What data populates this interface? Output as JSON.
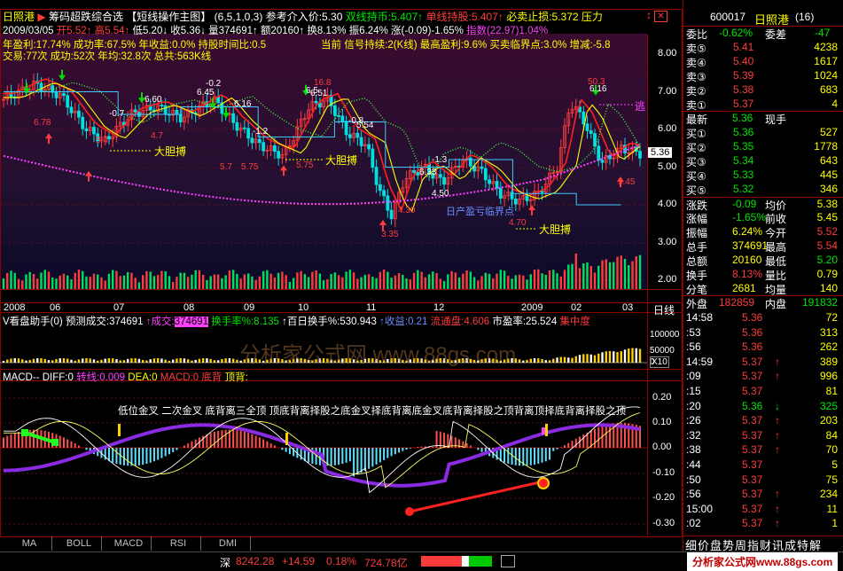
{
  "header": {
    "stock_name": "日照港",
    "indicator_name": "筹码超跌综合选",
    "template_name": "【短线操作主图】",
    "params": "(6,5,1,0,3)",
    "ref_price_label": "参考介入价:",
    "ref_price": "5.30",
    "hold_label": "双线持币:",
    "hold_value": "5.407",
    "single_label": "单线持股:",
    "single_value": "5.407",
    "stop_label": "必卖止损:",
    "stop_value": "5.372",
    "pressure_label": "压力",
    "up_arrow": "↑",
    "down_arrow": "↓"
  },
  "ohlc_bar": {
    "date": "2009/03/05",
    "open": "开5.52",
    "high": "高5.54",
    "low": "低5.20",
    "close": "收5.36",
    "vol": "量374691",
    "amount": "额20160",
    "turnover": "换8.13%",
    "amplitude": "振6.24%",
    "change": "涨(-0.09)-1.65%",
    "index": "指数(22.97)1.04%"
  },
  "stats_line1": {
    "left": "年盈利:17.74% 成功率:67.5% 年收益:0.0% 持股时间比:0.5",
    "right": "当前 信号持续:2(K线) 最高盈利:9.6% 买卖临界点:3.0% 增减:-5.8"
  },
  "stats_line2": "交易:77次 成功:52次 年均:32.8次 总共:563K线",
  "chart_annotations": {
    "big_buy": "大胆搏",
    "escape": "逃",
    "mid_point": "日产盈亏临界点",
    "labels": [
      "6.78",
      "6.60",
      "6.45",
      "-0.2",
      "6.16",
      "-0.7",
      "4.7",
      "6.5",
      "-1.2",
      "5.7",
      "6.51",
      "16.8",
      "-0.8",
      "5.75",
      "5.54",
      "5.4",
      "6.33",
      "-1.3",
      "4.30",
      "4.50",
      "3.35",
      "50.3",
      "6.16",
      "5.45",
      "5.75",
      "4.70"
    ]
  },
  "price_axis": [
    "8.00",
    "7.00",
    "6.00",
    "5.00",
    "4.00",
    "3.00",
    "2.00"
  ],
  "current_price_tag": "5.36",
  "date_axis": [
    "2008",
    "06",
    "07",
    "08",
    "09",
    "10",
    "11",
    "12",
    "2009",
    "02",
    "03"
  ],
  "date_axis_right": "日线",
  "vol_panel": {
    "title": "V看盘助手(0)",
    "predict": "预测成交:374691",
    "traded_label": "↑成交:",
    "traded_value": "374691",
    "turnover_label": "换手率%:",
    "turnover_value": "8.135",
    "hundred_label": "↑百日换手%:",
    "hundred_value": "530.943",
    "gain_label": "↑收益:",
    "gain_value": "0.21",
    "float_label": "流通盘:",
    "float_value": "4.606",
    "pe_label": "市盈率:",
    "pe_value": "25.524",
    "conc_label": "集中度",
    "axis": [
      "100000",
      "50000",
      "0"
    ],
    "axis_mult": "X10",
    "watermark": "分析家公式网 www.88gs.com"
  },
  "macd_panel": {
    "title": "MACD--",
    "diff": "DIFF:0",
    "turn_label": "转线:",
    "turn_value": "0.009",
    "dea": "DEA:0",
    "macd": "MACD:0",
    "bottom_label": "底背",
    "top_label": "顶背:",
    "signals": "低位金叉 二次金叉 底背离三全顶 顶底背离择股之底金叉择底背离底金叉底背离择股之顶背离顶择底背离择股之顶",
    "axis": [
      "0.20",
      "0.10",
      "0.00",
      "-0.10",
      "-0.20",
      "-0.30"
    ]
  },
  "tabs": [
    "MA",
    "BOLL",
    "MACD",
    "RSI",
    "DMI"
  ],
  "right": {
    "code": "600017",
    "name": "日照港",
    "page": "(16)",
    "webi_label": "委比",
    "webi_value": "-0.62%",
    "weicha_label": "委差",
    "weicha_value": "-47",
    "asks": [
      {
        "label": "卖⑤",
        "price": "5.41",
        "vol": "4238"
      },
      {
        "label": "卖④",
        "price": "5.40",
        "vol": "1617"
      },
      {
        "label": "卖③",
        "price": "5.39",
        "vol": "1024"
      },
      {
        "label": "卖②",
        "price": "5.38",
        "vol": "683"
      },
      {
        "label": "卖①",
        "price": "5.37",
        "vol": "4"
      }
    ],
    "last_label": "最新",
    "last_value": "5.36",
    "last_type": "现手",
    "bids": [
      {
        "label": "买①",
        "price": "5.36",
        "vol": "527"
      },
      {
        "label": "买②",
        "price": "5.35",
        "vol": "1778"
      },
      {
        "label": "买③",
        "price": "5.34",
        "vol": "643"
      },
      {
        "label": "买④",
        "price": "5.33",
        "vol": "445"
      },
      {
        "label": "买⑤",
        "price": "5.32",
        "vol": "346"
      }
    ],
    "stats": [
      {
        "l1": "涨跌",
        "v1": "-0.09",
        "l2": "均价",
        "v2": "5.38"
      },
      {
        "l1": "涨幅",
        "v1": "-1.65%",
        "l2": "前收",
        "v2": "5.45"
      },
      {
        "l1": "振幅",
        "v1": "6.24%",
        "l2": "今开",
        "v2": "5.52"
      },
      {
        "l1": "总手",
        "v1": "374691",
        "l2": "最高",
        "v2": "5.54"
      },
      {
        "l1": "总额",
        "v1": "20160",
        "l2": "最低",
        "v2": "5.20"
      },
      {
        "l1": "换手",
        "v1": "8.13%",
        "l2": "量比",
        "v2": "0.79"
      },
      {
        "l1": "分笔",
        "v1": "2681",
        "l2": "均量",
        "v2": "140"
      }
    ],
    "outer_label": "外盘",
    "outer_value": "182859",
    "inner_label": "内盘",
    "inner_value": "191832",
    "ticks": [
      {
        "t": "14:58",
        "p": "5.36",
        "a": "",
        "v": "72"
      },
      {
        "t": ":53",
        "p": "5.36",
        "a": "",
        "v": "313"
      },
      {
        "t": ":56",
        "p": "5.36",
        "a": "",
        "v": "262"
      },
      {
        "t": "14:59",
        "p": "5.37",
        "a": "↑",
        "v": "389"
      },
      {
        "t": ":09",
        "p": "5.37",
        "a": "↑",
        "v": "996"
      },
      {
        "t": ":15",
        "p": "5.37",
        "a": "",
        "v": "81"
      },
      {
        "t": ":20",
        "p": "5.36",
        "a": "↓",
        "v": "325"
      },
      {
        "t": ":26",
        "p": "5.37",
        "a": "↑",
        "v": "203"
      },
      {
        "t": ":32",
        "p": "5.37",
        "a": "↑",
        "v": "84"
      },
      {
        "t": ":38",
        "p": "5.37",
        "a": "↑",
        "v": "70"
      },
      {
        "t": ":44",
        "p": "5.37",
        "a": "",
        "v": "5"
      },
      {
        "t": ":50",
        "p": "5.37",
        "a": "",
        "v": "75"
      },
      {
        "t": ":56",
        "p": "5.37",
        "a": "↑",
        "v": "234"
      },
      {
        "t": "15:00",
        "p": "5.37",
        "a": "↑",
        "v": "11"
      },
      {
        "t": ":02",
        "p": "5.37",
        "a": "↑",
        "v": "1"
      }
    ],
    "bottom_tabs": "细价盘势周指财讯成特解"
  },
  "status": {
    "index_label": "深",
    "index_value": "8242.28",
    "index_change": "+14.59",
    "index_pct": "0.18%",
    "index_amount": "724.78亿",
    "site": "分析家公式网www.88gs.com"
  }
}
